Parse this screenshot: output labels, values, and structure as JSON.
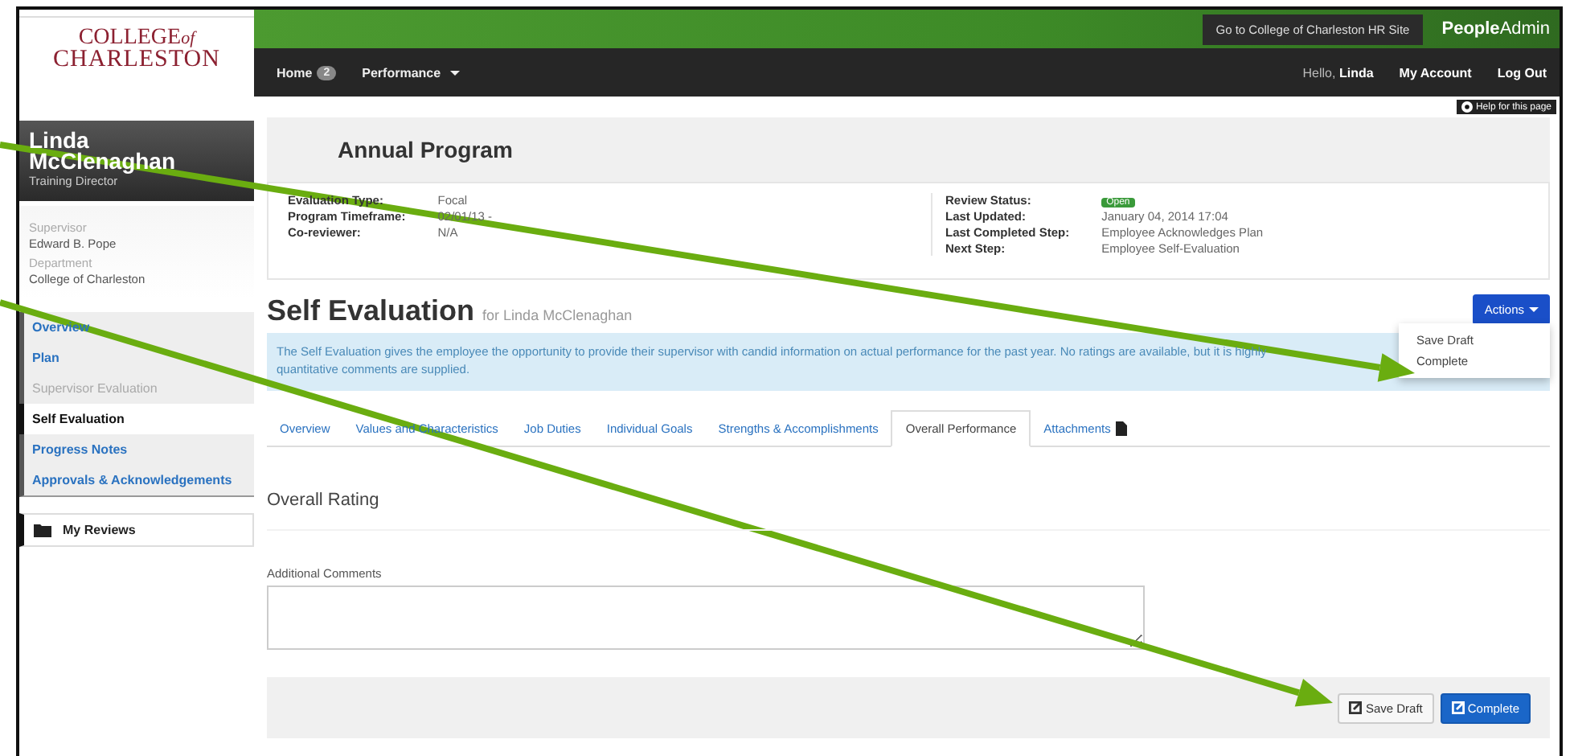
{
  "logo": {
    "line1": "COLLEGE",
    "of": "of",
    "line2": "CHARLESTON"
  },
  "topbar": {
    "hr_link": "Go to College of Charleston HR Site",
    "brand_bold": "People",
    "brand_light": "Admin"
  },
  "navbar": {
    "items": [
      {
        "label": "Home",
        "badge": "2",
        "dropdown": false
      },
      {
        "label": "Performance",
        "dropdown": true
      }
    ],
    "greeting": "Hello,",
    "user": "Linda",
    "links": [
      "My Account",
      "Log Out"
    ]
  },
  "help": "Help for this page",
  "profile": {
    "name": "Linda McClenaghan",
    "title": "Training Director",
    "fields": [
      {
        "label": "Supervisor",
        "value": "Edward B. Pope"
      },
      {
        "label": "Department",
        "value": "College of Charleston"
      }
    ]
  },
  "sidebar": {
    "items": [
      {
        "label": "Overview",
        "selected": false,
        "disabled": false
      },
      {
        "label": "Plan",
        "selected": false,
        "disabled": false
      },
      {
        "label": "Supervisor Evaluation",
        "selected": false,
        "disabled": true
      },
      {
        "label": "Self Evaluation",
        "selected": true,
        "disabled": false
      },
      {
        "label": "Progress Notes",
        "selected": false,
        "disabled": false
      },
      {
        "label": "Approvals & Acknowledgements",
        "selected": false,
        "disabled": false
      }
    ],
    "my_reviews": "My Reviews"
  },
  "program": {
    "title": "Annual Program",
    "left": [
      {
        "label": "Evaluation Type:",
        "value": "Focal"
      },
      {
        "label": "Program Timeframe:",
        "value": "02/01/13 -"
      },
      {
        "label": "Co-reviewer:",
        "value": "N/A"
      }
    ],
    "right": [
      {
        "label": "Review Status:",
        "value": "Open",
        "kind": "badge"
      },
      {
        "label": "Last Updated:",
        "value": "January 04, 2014 17:04",
        "kind": "text"
      },
      {
        "label": "Last Completed Step:",
        "value": "Employee Acknowledges Plan",
        "kind": "text"
      },
      {
        "label": "Next Step:",
        "value": "Employee Self-Evaluation",
        "kind": "text"
      }
    ]
  },
  "page": {
    "title": "Self Evaluation",
    "subtitle": "for Linda McClenaghan",
    "actions": {
      "label": "Actions",
      "expanded": true,
      "items": [
        "Save Draft",
        "Complete"
      ]
    },
    "alert": [
      "The Self Evaluation gives the employee the opportunity to provide their supervisor with candid information on actual performance for the past year. No ratings are available, but it is highly",
      "quantitative comments are supplied."
    ]
  },
  "tabs": [
    {
      "label": "Overview",
      "selected": false
    },
    {
      "label": "Values and Characteristics",
      "selected": false
    },
    {
      "label": "Job Duties",
      "selected": false
    },
    {
      "label": "Individual Goals",
      "selected": false
    },
    {
      "label": "Strengths & Accomplishments",
      "selected": false
    },
    {
      "label": "Overall Performance",
      "selected": true
    },
    {
      "label": "Attachments",
      "selected": false,
      "icon": true
    }
  ],
  "section": {
    "title": "Overall Rating",
    "comments_label": "Additional Comments"
  },
  "footer": {
    "buttons": [
      {
        "label": "Save Draft",
        "kind": "default"
      },
      {
        "label": "Complete",
        "kind": "primary"
      }
    ]
  },
  "annotations": [
    {
      "kind": "arrow"
    },
    {
      "kind": "arrow"
    }
  ]
}
